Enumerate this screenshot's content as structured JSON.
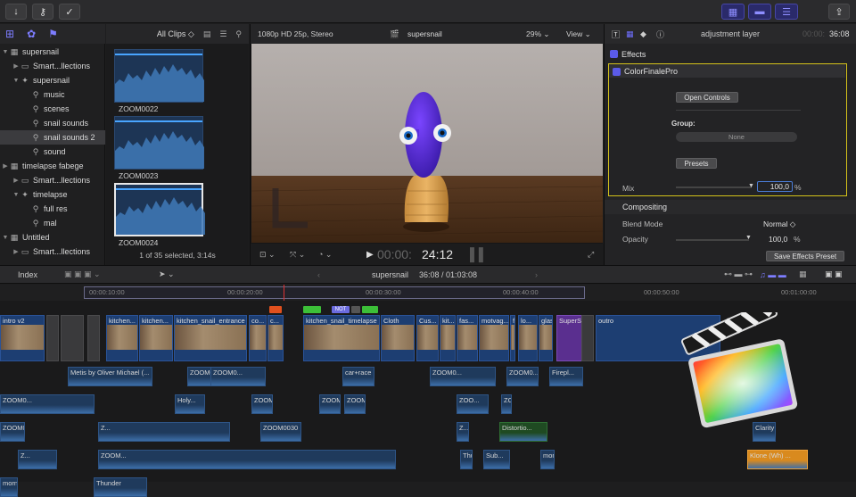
{
  "topbar": {
    "left_icons": [
      "↓",
      "⚷",
      "✓"
    ],
    "right_icons": [
      "▦",
      "▬",
      "☰",
      "⇪"
    ]
  },
  "library": {
    "icons": [
      "⊞",
      "✿",
      "⚑"
    ],
    "items": [
      {
        "label": "supersnail",
        "indent": 0,
        "tri": "▼",
        "icon": "▦",
        "selected": false
      },
      {
        "label": "Smart...llections",
        "indent": 1,
        "tri": "▶",
        "icon": "▭",
        "selected": false
      },
      {
        "label": "supersnail",
        "indent": 1,
        "tri": "▼",
        "icon": "✦",
        "selected": false
      },
      {
        "label": "music",
        "indent": 2,
        "tri": "",
        "icon": "⚲",
        "selected": false
      },
      {
        "label": "scenes",
        "indent": 2,
        "tri": "",
        "icon": "⚲",
        "selected": false
      },
      {
        "label": "snail sounds",
        "indent": 2,
        "tri": "",
        "icon": "⚲",
        "selected": false
      },
      {
        "label": "snail sounds 2",
        "indent": 2,
        "tri": "",
        "icon": "⚲",
        "selected": true
      },
      {
        "label": "sound",
        "indent": 2,
        "tri": "",
        "icon": "⚲",
        "selected": false
      },
      {
        "label": "timelapse fabege",
        "indent": 0,
        "tri": "▶",
        "icon": "▦",
        "selected": false
      },
      {
        "label": "Smart...llections",
        "indent": 1,
        "tri": "▶",
        "icon": "▭",
        "selected": false
      },
      {
        "label": "timelapse",
        "indent": 1,
        "tri": "▼",
        "icon": "✦",
        "selected": false
      },
      {
        "label": "full res",
        "indent": 2,
        "tri": "",
        "icon": "⚲",
        "selected": false
      },
      {
        "label": "mal",
        "indent": 2,
        "tri": "",
        "icon": "⚲",
        "selected": false
      },
      {
        "label": "Untitled",
        "indent": 0,
        "tri": "▼",
        "icon": "▦",
        "selected": false
      },
      {
        "label": "Smart...llections",
        "indent": 1,
        "tri": "▶",
        "icon": "▭",
        "selected": false
      }
    ]
  },
  "browser": {
    "filter": "All Clips ◇",
    "clips": [
      {
        "name": "ZOOM0022",
        "selected": false
      },
      {
        "name": "ZOOM0023",
        "selected": false
      },
      {
        "name": "ZOOM0024",
        "selected": true
      }
    ],
    "status": "1 of 35 selected, 3:14s"
  },
  "viewer": {
    "format": "1080p HD 25p, Stereo",
    "title": "supersnail",
    "zoom": "29% ⌄",
    "view": "View ⌄",
    "timecode_dim": "00:00:",
    "timecode_bright": "24:12"
  },
  "inspector": {
    "title": "adjustment layer",
    "time_dim": "00:00:",
    "time_bright": "36:08",
    "effects_label": "Effects",
    "plugin": "ColorFinalePro",
    "open_controls": "Open Controls",
    "group_label": "Group:",
    "group_value": "None",
    "presets": "Presets",
    "mix_label": "Mix",
    "mix_value": "100,0",
    "mix_unit": "%",
    "compositing": "Compositing",
    "blend_label": "Blend Mode",
    "blend_value": "Normal ◇",
    "opacity_label": "Opacity",
    "opacity_value": "100,0",
    "opacity_unit": "%",
    "save_preset": "Save Effects Preset",
    "accent": "#d4c21a"
  },
  "timeline": {
    "index_label": "Index",
    "project": "supersnail",
    "duration": "36:08 / 01:03:08",
    "ruler": [
      "00:00:10:00",
      "00:00:20:00",
      "00:00:30:00",
      "00:00:40:00",
      "00:00:50:00",
      "00:01:00:00"
    ],
    "title_marker": "NOT",
    "primary_clips": [
      "intro v2",
      "kitchen...",
      "kitchen...",
      "kitchen_snail_entrance",
      "co...",
      "c...",
      "kitchen_snail_timelapse",
      "Cloth",
      "Cus...",
      "kit...",
      "fas...",
      "motvag...",
      "f",
      "lo...",
      "glass...",
      "SuperSnail - Scrolling",
      "outro"
    ],
    "audio": [
      "Metis by Oliver Michael (...",
      "ZOOM0021",
      "ZOOM0...",
      "car+race",
      "ZOOM0...",
      "ZOOM0...",
      "Firepl...",
      "ZOOM0...",
      "Holy...",
      "ZOOM...",
      "ZOOM0...",
      "ZOOM0...",
      "ZOO...",
      "ZOOM0012",
      "ZOOM0024",
      "Z...",
      "ZOOM0030",
      "Z...",
      "Distortio...",
      "Clarity by Ian Post (Eternity) Artist",
      "Z...",
      "ZOOM...",
      "Thunder",
      "Sub...",
      "morning...",
      "Klone (Wh) ...",
      "morni...",
      "Thunder"
    ]
  }
}
